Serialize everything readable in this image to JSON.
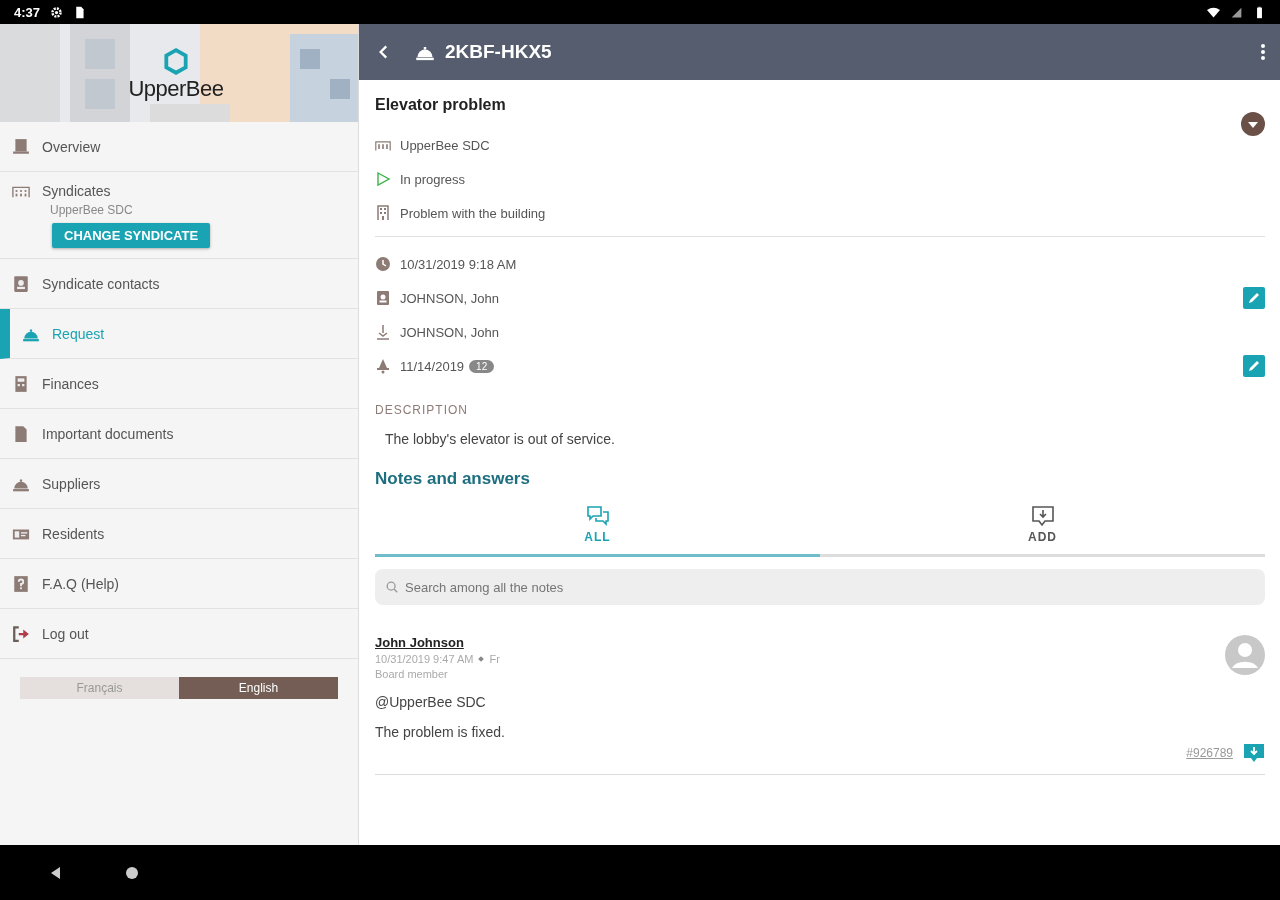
{
  "status_bar": {
    "time": "4:37"
  },
  "sidebar": {
    "brand": "UpperBee",
    "items": [
      {
        "label": "Overview",
        "selected": false
      },
      {
        "label": "Syndicates",
        "selected": false,
        "sublabel": "UpperBee SDC",
        "button": "CHANGE SYNDICATE"
      },
      {
        "label": "Syndicate contacts",
        "selected": false
      },
      {
        "label": "Request",
        "selected": true
      },
      {
        "label": "Finances",
        "selected": false
      },
      {
        "label": "Important documents",
        "selected": false
      },
      {
        "label": "Suppliers",
        "selected": false
      },
      {
        "label": "Residents",
        "selected": false
      },
      {
        "label": "F.A.Q (Help)",
        "selected": false
      },
      {
        "label": "Log out",
        "selected": false
      }
    ],
    "languages": [
      {
        "label": "Français",
        "selected": false
      },
      {
        "label": "English",
        "selected": true
      }
    ]
  },
  "header": {
    "title": "2KBF-HKX5"
  },
  "request": {
    "title": "Elevator problem",
    "summary": [
      {
        "kind": "syndicate",
        "text": "UpperBee SDC"
      },
      {
        "kind": "status",
        "text": "In progress"
      },
      {
        "kind": "category",
        "text": "Problem with the building"
      }
    ],
    "details": [
      {
        "kind": "date",
        "text": "10/31/2019 9:18 AM",
        "editable": false
      },
      {
        "kind": "author",
        "text": "JOHNSON, John",
        "editable": true
      },
      {
        "kind": "assignee",
        "text": "JOHNSON, John",
        "editable": false
      },
      {
        "kind": "due",
        "text": "11/14/2019",
        "badge": "12",
        "editable": true
      }
    ],
    "description_label": "DESCRIPTION",
    "description": "The lobby's elevator is out of service."
  },
  "notes": {
    "title": "Notes and answers",
    "tabs": [
      {
        "label": "ALL",
        "selected": true
      },
      {
        "label": "ADD",
        "selected": false
      }
    ],
    "search": {
      "placeholder": "Search among all the notes"
    },
    "items": [
      {
        "author": "John Johnson",
        "time": "10/31/2019 9:47 AM",
        "lang": "Fr",
        "role": "Board member",
        "mention": "@UpperBee SDC",
        "body": "The problem is fixed.",
        "ref": "#926789"
      }
    ]
  }
}
